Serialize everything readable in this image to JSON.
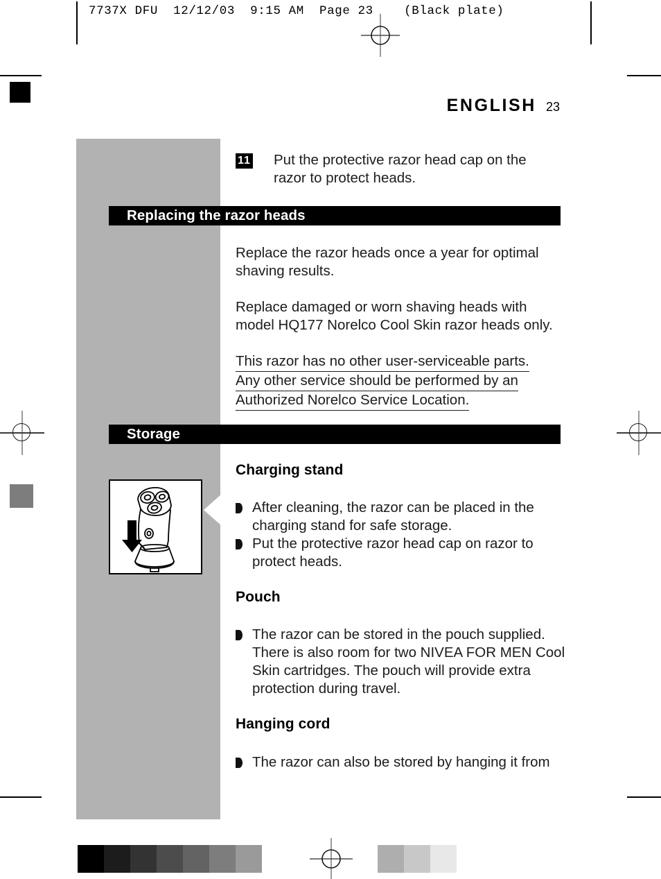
{
  "slug": {
    "text": "7737X DFU  12/12/03  9:15 AM  Page 23    (Black plate)"
  },
  "running_head": {
    "language": "ENGLISH",
    "page_number": "23"
  },
  "step": {
    "number": "11",
    "text": "Put the protective razor head cap on the razor to protect heads."
  },
  "sections": [
    {
      "banner": "Replacing the razor heads",
      "paragraphs": [
        "Replace the razor heads once a year for optimal shaving results.",
        "Replace damaged or worn shaving heads with model HQ177 Norelco Cool Skin razor heads only."
      ],
      "underlined_lines": [
        "This razor has no other user-serviceable parts.",
        "Any other service should be performed by an",
        "Authorized Norelco Service Location."
      ]
    },
    {
      "banner": "Storage",
      "subsections": [
        {
          "heading": "Charging stand",
          "bullets": [
            "After cleaning, the razor can be placed in the charging stand for safe storage.",
            "Put the protective razor head cap on razor to protect heads."
          ]
        },
        {
          "heading": "Pouch",
          "bullets": [
            "The razor can be stored in the pouch supplied. There is also room for two NIVEA FOR MEN Cool Skin cartridges. The pouch will provide extra protection during travel."
          ]
        },
        {
          "heading": "Hanging cord",
          "bullets": [
            "The razor can also be stored by hanging it from"
          ]
        }
      ]
    }
  ],
  "figure": {
    "caption_icon": "razor-in-charging-stand-illustration",
    "arrow_direction": "down"
  },
  "calibration": {
    "left_swatches": [
      "#000000",
      "#1c1c1c",
      "#333333",
      "#4c4c4c",
      "#636363",
      "#7d7d7d",
      "#9a9a9a"
    ],
    "right_swatches": [
      "#aeaeae",
      "#c8c8c8",
      "#e8e8e8"
    ]
  },
  "marks": {
    "corner_square_color": "#000000",
    "tone_square_color": "#7d7d7d",
    "side_column_color": "#b2b2b2",
    "banner_color": "#000000"
  }
}
